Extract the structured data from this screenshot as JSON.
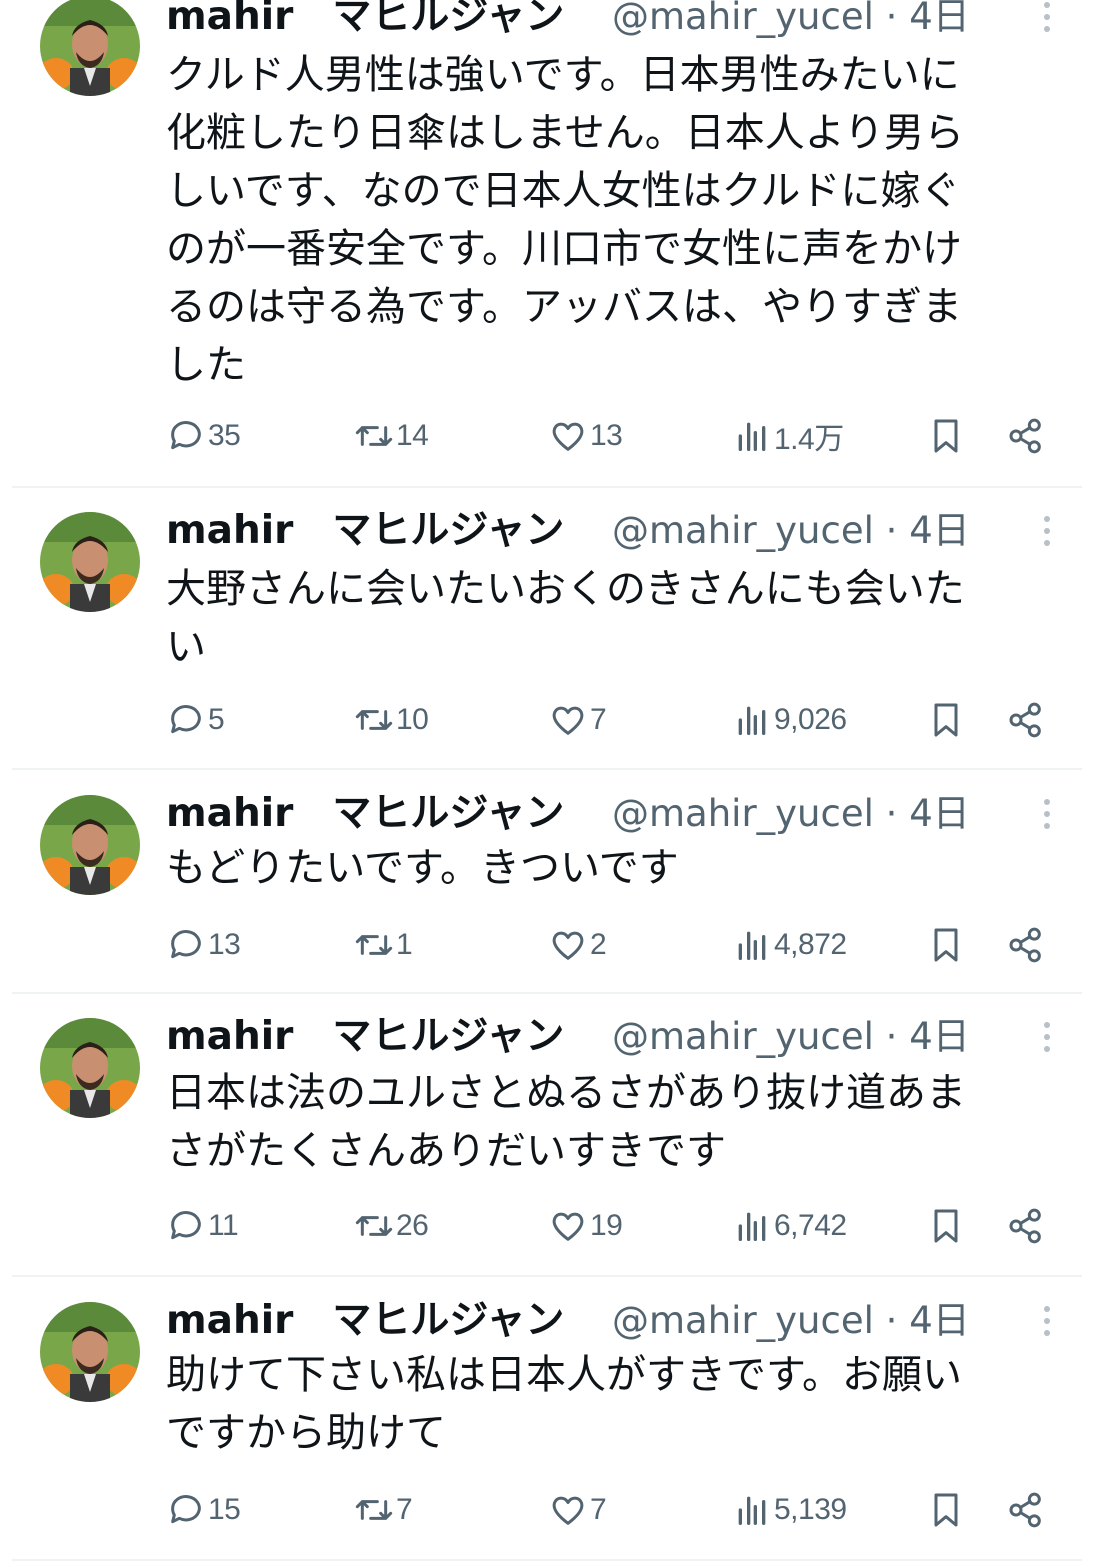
{
  "tweets": [
    {
      "display_name": "mahir　マヒルジャン",
      "handle": "@mahir_yucel",
      "separator": "·",
      "time": "4日",
      "text": "クルド人男性は強いです。日本男性みたいに\n化粧したり日傘はしません。日本人より男ら\nしいです、なので日本人女性はクルドに嫁ぐ\nのが一番安全です。川口市で女性に声をかけ\nるのは守る為です。アッバスは、やりすぎま\nした",
      "replies": "35",
      "retweets": "14",
      "likes": "13",
      "views": "1.4万"
    },
    {
      "display_name": "mahir　マヒルジャン",
      "handle": "@mahir_yucel",
      "separator": "·",
      "time": "4日",
      "text": "大野さんに会いたいおくのきさんにも会いた\nい",
      "replies": "5",
      "retweets": "10",
      "likes": "7",
      "views": "9,026"
    },
    {
      "display_name": "mahir　マヒルジャン",
      "handle": "@mahir_yucel",
      "separator": "·",
      "time": "4日",
      "text": "もどりたいです。きついです",
      "replies": "13",
      "retweets": "1",
      "likes": "2",
      "views": "4,872"
    },
    {
      "display_name": "mahir　マヒルジャン",
      "handle": "@mahir_yucel",
      "separator": "·",
      "time": "4日",
      "text": "日本は法のユルさとぬるさがあり抜け道あま\nさがたくさんありだいすきです",
      "replies": "11",
      "retweets": "26",
      "likes": "19",
      "views": "6,742"
    },
    {
      "display_name": "mahir　マヒルジャン",
      "handle": "@mahir_yucel",
      "separator": "·",
      "time": "4日",
      "text": "助けて下さい私は日本人がすきです。お願い\nですから助けて",
      "replies": "15",
      "retweets": "7",
      "likes": "7",
      "views": "5,139"
    }
  ],
  "colors": {
    "text": "#0f1419",
    "muted": "#536471",
    "divider": "#eff3f4"
  },
  "icons": [
    "reply-icon",
    "retweet-icon",
    "like-icon",
    "views-icon",
    "bookmark-icon",
    "share-icon",
    "more-icon"
  ]
}
